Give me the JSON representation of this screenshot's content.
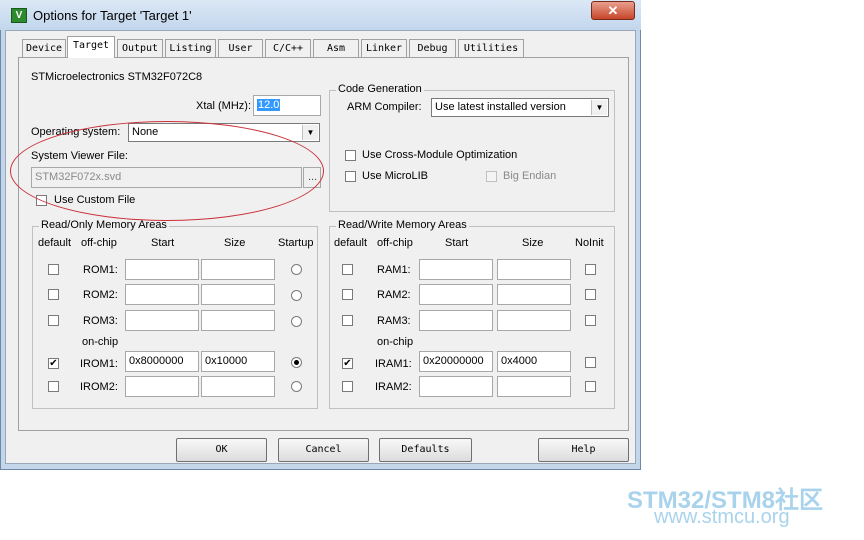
{
  "window": {
    "title": "Options for Target 'Target 1'",
    "close_glyph": "✕",
    "icon_letter": "V"
  },
  "tabs": [
    {
      "label": "Device",
      "active": false
    },
    {
      "label": "Target",
      "active": true
    },
    {
      "label": "Output",
      "active": false
    },
    {
      "label": "Listing",
      "active": false
    },
    {
      "label": "User",
      "active": false
    },
    {
      "label": "C/C++",
      "active": false
    },
    {
      "label": "Asm",
      "active": false
    },
    {
      "label": "Linker",
      "active": false
    },
    {
      "label": "Debug",
      "active": false
    },
    {
      "label": "Utilities",
      "active": false
    }
  ],
  "target": {
    "device_name": "STMicroelectronics STM32F072C8",
    "xtal_label": "Xtal (MHz):",
    "xtal_value": "12.0",
    "os_label": "Operating system:",
    "os_value": "None",
    "svf_label": "System Viewer File:",
    "svf_value": "STM32F072x.svd",
    "browse_label": "...",
    "custom_file_label": "Use Custom File"
  },
  "codegen": {
    "title": "Code Generation",
    "compiler_label": "ARM Compiler:",
    "compiler_value": "Use latest installed version",
    "cross_module_label": "Use Cross-Module Optimization",
    "microlib_label": "Use MicroLIB",
    "big_endian_label": "Big Endian"
  },
  "rom": {
    "title": "Read/Only Memory Areas",
    "headers": {
      "default": "default",
      "offchip": "off-chip",
      "start": "Start",
      "size": "Size",
      "last": "Startup"
    },
    "onchip_label": "on-chip",
    "rows": [
      {
        "name": "ROM1:",
        "start": "",
        "size": "",
        "default": false,
        "radio": false
      },
      {
        "name": "ROM2:",
        "start": "",
        "size": "",
        "default": false,
        "radio": false
      },
      {
        "name": "ROM3:",
        "start": "",
        "size": "",
        "default": false,
        "radio": false
      },
      {
        "name": "IROM1:",
        "start": "0x8000000",
        "size": "0x10000",
        "default": true,
        "radio": true
      },
      {
        "name": "IROM2:",
        "start": "",
        "size": "",
        "default": false,
        "radio": false
      }
    ]
  },
  "ram": {
    "title": "Read/Write Memory Areas",
    "headers": {
      "default": "default",
      "offchip": "off-chip",
      "start": "Start",
      "size": "Size",
      "last": "NoInit"
    },
    "onchip_label": "on-chip",
    "rows": [
      {
        "name": "RAM1:",
        "start": "",
        "size": "",
        "default": false,
        "noinit": false
      },
      {
        "name": "RAM2:",
        "start": "",
        "size": "",
        "default": false,
        "noinit": false
      },
      {
        "name": "RAM3:",
        "start": "",
        "size": "",
        "default": false,
        "noinit": false
      },
      {
        "name": "IRAM1:",
        "start": "0x20000000",
        "size": "0x4000",
        "default": true,
        "noinit": false
      },
      {
        "name": "IRAM2:",
        "start": "",
        "size": "",
        "default": false,
        "noinit": false
      }
    ]
  },
  "buttons": {
    "ok": "OK",
    "cancel": "Cancel",
    "defaults": "Defaults",
    "help": "Help"
  },
  "watermark": {
    "line1": "STM32/STM8社区",
    "line2": "www.stmcu.org"
  },
  "colors": {
    "annotation": "#c8323a",
    "selection": "#3399ff",
    "watermark": "#a9d3ec"
  }
}
